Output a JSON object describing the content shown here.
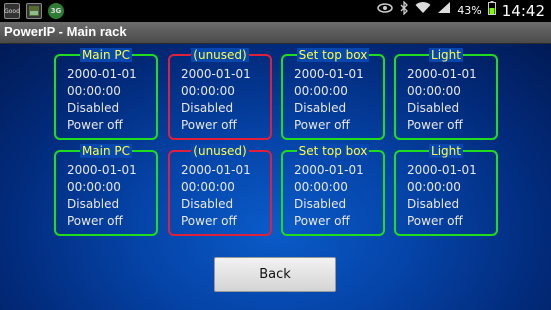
{
  "status_bar": {
    "left_icons": [
      "notification-icon",
      "gallery-icon",
      "app-icon"
    ],
    "left_icon_labels": [
      "Good",
      "",
      "3G"
    ],
    "right_icons": [
      "eye-icon",
      "bluetooth-icon",
      "wifi-icon",
      "signal-icon",
      "battery-icon"
    ],
    "battery": "43%",
    "time": "14:42"
  },
  "title_bar": {
    "title": "PowerIP - Main rack"
  },
  "outlets": [
    {
      "name": "Main PC",
      "date": "2000-01-01",
      "time": "00:00:00",
      "state": "Disabled",
      "power": "Power off",
      "border": "#1fdc1f"
    },
    {
      "name": "(unused)",
      "date": "2000-01-01",
      "time": "00:00:00",
      "state": "Disabled",
      "power": "Power off",
      "border": "#e0203a"
    },
    {
      "name": "Set top box",
      "date": "2000-01-01",
      "time": "00:00:00",
      "state": "Disabled",
      "power": "Power off",
      "border": "#1fdc1f"
    },
    {
      "name": "Light",
      "date": "2000-01-01",
      "time": "00:00:00",
      "state": "Disabled",
      "power": "Power off",
      "border": "#1fdc1f"
    },
    {
      "name": "Main PC",
      "date": "2000-01-01",
      "time": "00:00:00",
      "state": "Disabled",
      "power": "Power off",
      "border": "#1fdc1f"
    },
    {
      "name": "(unused)",
      "date": "2000-01-01",
      "time": "00:00:00",
      "state": "Disabled",
      "power": "Power off",
      "border": "#e0203a"
    },
    {
      "name": "Set top box",
      "date": "2000-01-01",
      "time": "00:00:00",
      "state": "Disabled",
      "power": "Power off",
      "border": "#1fdc1f"
    },
    {
      "name": "Light",
      "date": "2000-01-01",
      "time": "00:00:00",
      "state": "Disabled",
      "power": "Power off",
      "border": "#1fdc1f"
    }
  ],
  "colors": {
    "header_text": "#ffff44",
    "background": "#0544a8",
    "active_border": "#1fdc1f",
    "unused_border": "#e0203a"
  },
  "back_button": {
    "label": "Back"
  }
}
